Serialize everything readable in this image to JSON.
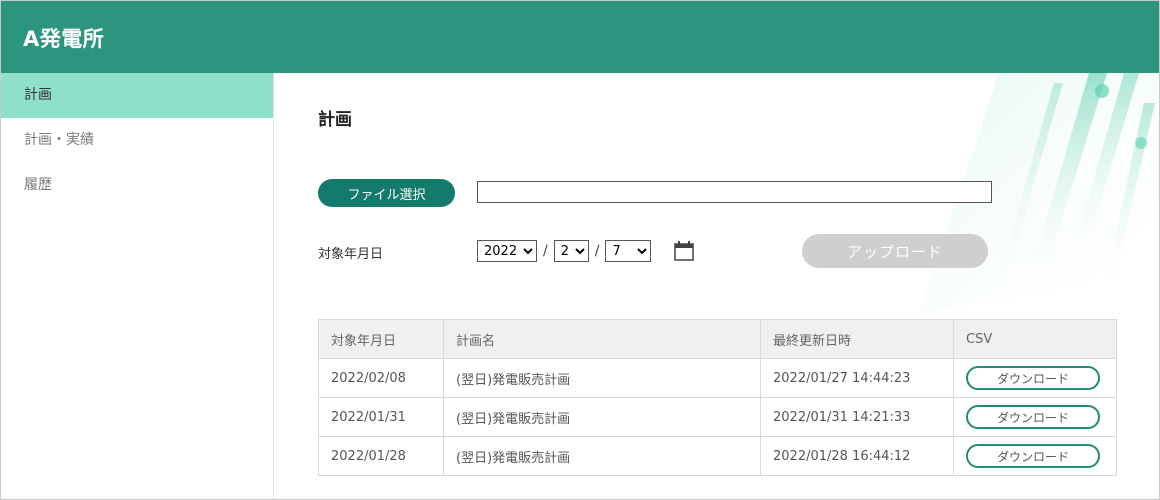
{
  "header": {
    "title": "A発電所"
  },
  "sidebar": {
    "items": [
      {
        "label": "計画",
        "active": true
      },
      {
        "label": "計画・実績",
        "active": false
      },
      {
        "label": "履歴",
        "active": false
      }
    ]
  },
  "main": {
    "title": "計画",
    "file_button": "ファイル選択",
    "file_value": "",
    "date_label": "対象年月日",
    "year": {
      "selected": "2022",
      "options": [
        "2022"
      ]
    },
    "month": {
      "selected": "2",
      "options": [
        "2"
      ]
    },
    "day": {
      "selected": "7",
      "options": [
        "7"
      ]
    },
    "separator": "/",
    "upload_button": "アップロード"
  },
  "table": {
    "headers": [
      "対象年月日",
      "計画名",
      "最終更新日時",
      "CSV"
    ],
    "rows": [
      {
        "date": "2022/02/08",
        "name": "(翌日)発電販売計画",
        "updated": "2022/01/27 14:44:23",
        "action": "ダウンロード"
      },
      {
        "date": "2022/01/31",
        "name": "(翌日)発電販売計画",
        "updated": "2022/01/31 14:21:33",
        "action": "ダウンロード"
      },
      {
        "date": "2022/01/28",
        "name": "(翌日)発電販売計画",
        "updated": "2022/01/28 16:44:12",
        "action": "ダウンロード"
      }
    ]
  },
  "colors": {
    "header": "#2c9580",
    "sidebar_active": "#8fe0c8",
    "primary_button": "#147a6c",
    "disabled_button": "#cfcfcf",
    "download_border": "#1f8b78"
  },
  "icons": {
    "calendar": "calendar-icon"
  }
}
